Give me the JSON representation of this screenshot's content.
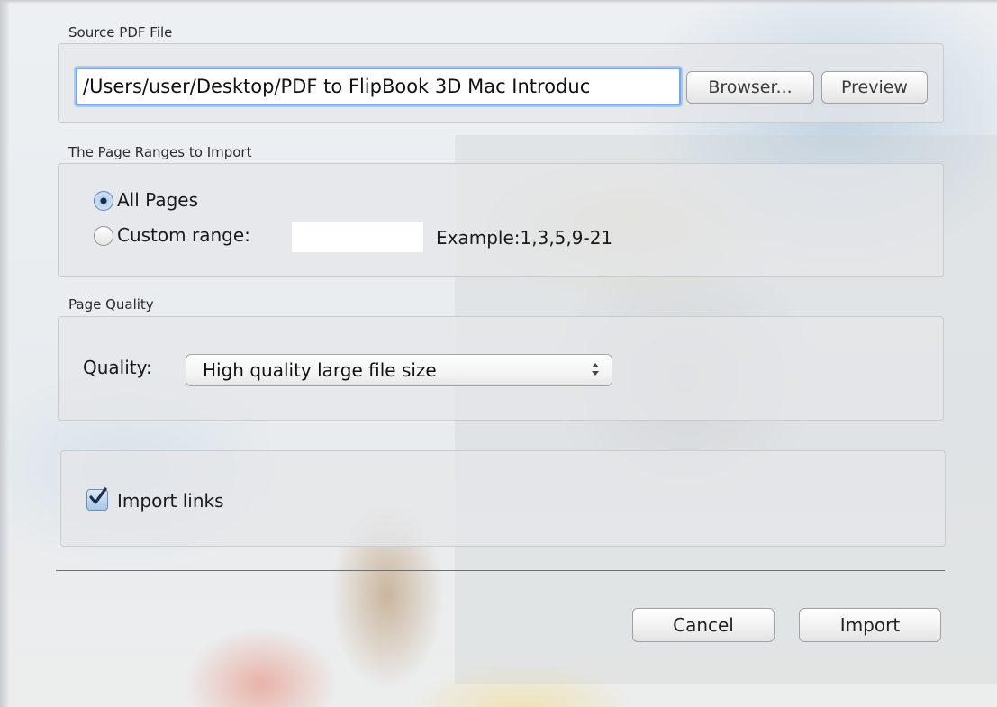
{
  "source": {
    "group_label": "Source PDF File",
    "path_value": "/Users/user/Desktop/PDF to FlipBook 3D Mac Introduc",
    "browse_label": "Browser...",
    "preview_label": "Preview"
  },
  "page_ranges": {
    "group_label": "The Page Ranges to Import",
    "all_pages_label": "All Pages",
    "all_pages_selected": true,
    "custom_range_label": "Custom range:",
    "custom_range_value": "",
    "example_text": "Example:1,3,5,9-21"
  },
  "page_quality": {
    "group_label": "Page Quality",
    "quality_label": "Quality:",
    "quality_value": "High quality large file size"
  },
  "links": {
    "import_links_label": "Import links",
    "import_links_checked": true
  },
  "footer": {
    "cancel_label": "Cancel",
    "import_label": "Import"
  },
  "colors": {
    "focus_ring": "#7aa7e3",
    "checkbox_fill": "#a9c6ea",
    "checkmark": "#1d2f4a"
  }
}
